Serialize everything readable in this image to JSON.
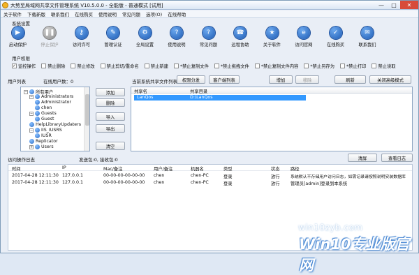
{
  "window": {
    "title": "大势至局域网共享文件管理系统 V10.5.0.0 - 全能版 - 普通模式 [试用]",
    "controls": {
      "minimize": "—",
      "maximize": "□",
      "close": "✕"
    }
  },
  "menubar": [
    "关于软件",
    "下载新版",
    "联系我们",
    "在线购买",
    "使用说明",
    "常见问题",
    "选项(O)",
    "在线帮助"
  ],
  "labels": {
    "system_settings": "系统设置",
    "user_permissions": "用户权限",
    "user_list": "用户列表",
    "online_users": "在线用户数：0",
    "share_list": "当前系统共享文件列表",
    "access_log": "访问操作日志",
    "packet_stats": "发送包:0, 接收包:0"
  },
  "toolbar": [
    {
      "label": "启动保护",
      "icon": "play-icon",
      "disabled": false,
      "glyph": "▶"
    },
    {
      "label": "停止保护",
      "icon": "pause-icon",
      "disabled": true,
      "glyph": "❚❚"
    },
    {
      "label": "访问许可",
      "icon": "key-icon",
      "disabled": false,
      "glyph": "⚷"
    },
    {
      "label": "管理认证",
      "icon": "certificate-icon",
      "disabled": false,
      "glyph": "✎"
    },
    {
      "label": "全局设置",
      "icon": "settings-icon",
      "disabled": false,
      "glyph": "⚙"
    },
    {
      "label": "使用说明",
      "icon": "help-book-icon",
      "disabled": false,
      "glyph": "?"
    },
    {
      "label": "常见问题",
      "icon": "faq-icon",
      "disabled": false,
      "glyph": "?"
    },
    {
      "label": "远程协助",
      "icon": "remote-assist-icon",
      "disabled": false,
      "glyph": "☎"
    },
    {
      "label": "关于软件",
      "icon": "about-icon",
      "disabled": false,
      "glyph": "★"
    },
    {
      "label": "访问官网",
      "icon": "website-icon",
      "disabled": false,
      "glyph": "e"
    },
    {
      "label": "在线购买",
      "icon": "cart-icon",
      "disabled": false,
      "glyph": "✓"
    },
    {
      "label": "联系我们",
      "icon": "contact-icon",
      "disabled": false,
      "glyph": "✉"
    }
  ],
  "permissions": [
    {
      "label": "监控操作",
      "checked": true
    },
    {
      "label": "禁止删除",
      "checked": false
    },
    {
      "label": "禁止修改",
      "checked": false
    },
    {
      "label": "禁止剪切/重命名",
      "checked": false
    },
    {
      "label": "禁止新建",
      "checked": false
    },
    {
      "label": "*禁止复制文件",
      "checked": false
    },
    {
      "label": "*禁止拖拽文件",
      "checked": false
    },
    {
      "label": "*禁止复制文件内容",
      "checked": false
    },
    {
      "label": "*禁止另存为",
      "checked": false
    },
    {
      "label": "*禁止打印",
      "checked": false
    },
    {
      "label": "禁止读取",
      "checked": false
    }
  ],
  "user_tree": [
    {
      "label": "所有用户",
      "level": 0,
      "expander": "−"
    },
    {
      "label": "Administrators",
      "level": 1,
      "expander": "−"
    },
    {
      "label": "Administrator",
      "level": 2,
      "expander": ""
    },
    {
      "label": "chen",
      "level": 2,
      "expander": ""
    },
    {
      "label": "Guests",
      "level": 1,
      "expander": "−"
    },
    {
      "label": "Guest",
      "level": 2,
      "expander": ""
    },
    {
      "label": "HelpLibraryUpdaters",
      "level": 1,
      "expander": ""
    },
    {
      "label": "IIS_IUSRS",
      "level": 1,
      "expander": "−"
    },
    {
      "label": "IUSR",
      "level": 2,
      "expander": ""
    },
    {
      "label": "Replicator",
      "level": 1,
      "expander": ""
    },
    {
      "label": "Users",
      "level": 1,
      "expander": "+"
    }
  ],
  "user_buttons": {
    "add": "添加",
    "delete": "删除",
    "import": "导入",
    "export": "导出",
    "clear": "清空"
  },
  "share_buttons": {
    "perm_dist": "权限分发",
    "client_list": "客户端列表",
    "add": "增加",
    "remove": "移除",
    "refresh": "刷新",
    "advanced_off": "关闭高级模式"
  },
  "share_table": {
    "columns": [
      "共享名",
      "共享目录"
    ],
    "rows": [
      [
        "LanQos",
        "D:\\LanQos"
      ]
    ]
  },
  "log_buttons": {
    "clear": "清屏",
    "view": "查看日志"
  },
  "log_table": {
    "columns": [
      "时间",
      "IP",
      "Mac/备注",
      "用户/备注",
      "机器名",
      "类型",
      "状态",
      "路径"
    ],
    "rows": [
      [
        "2017-04-28 12:11:30",
        "127.0.0.1",
        "00-00-00-00-00-00",
        "chen",
        "chen-PC",
        "登录",
        "放行",
        "系统默认不存储用户访问日志，如需记录请按照说明安装数据库"
      ],
      [
        "2017-04-28 12:11:30",
        "127.0.0.1",
        "00-00-00-00-00-00",
        "chen",
        "chen-PC",
        "登录",
        "放行",
        "管理员[admin]登录到本系统"
      ]
    ]
  },
  "watermark": {
    "line1": "win10zyb.com",
    "line2": "Win10专业版官网"
  }
}
